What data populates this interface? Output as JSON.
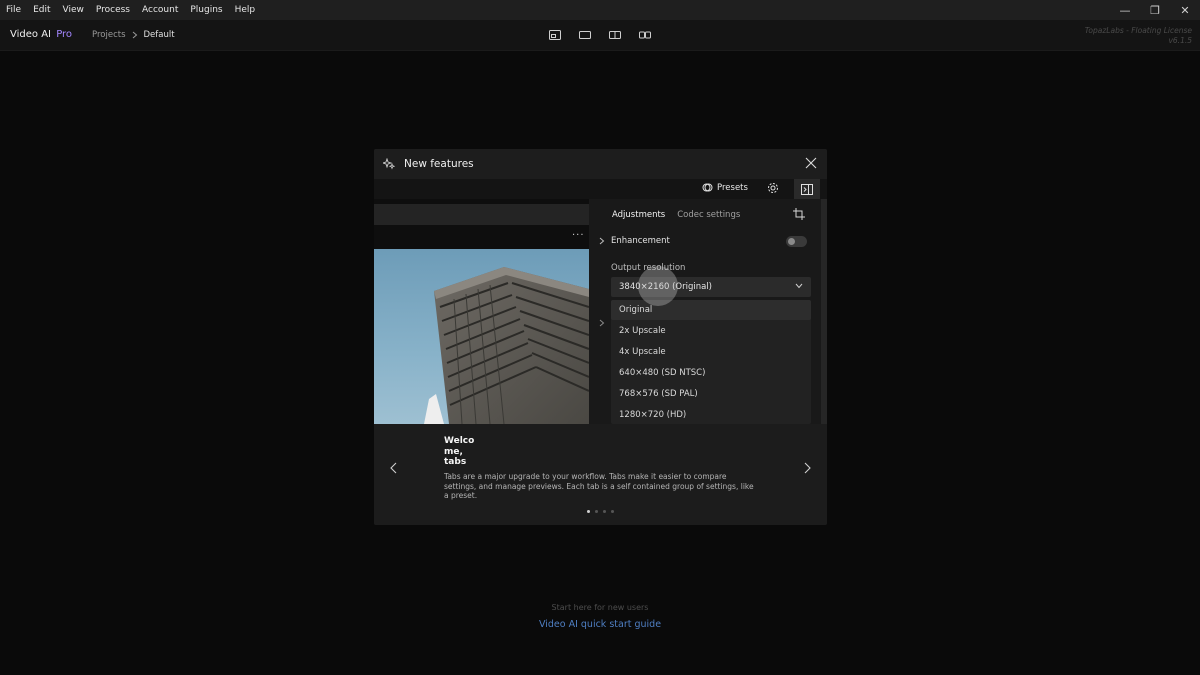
{
  "menubar": {
    "items": [
      "File",
      "Edit",
      "View",
      "Process",
      "Account",
      "Plugins",
      "Help"
    ]
  },
  "window_controls": {
    "minimize": "—",
    "restore": "❐",
    "close": "✕"
  },
  "app": {
    "name": "Video AI",
    "edition": "Pro",
    "breadcrumb": {
      "root": "Projects",
      "current": "Default"
    },
    "license_line1": "TopazLabs - Floating License",
    "license_line2": "v6.1.5"
  },
  "modal": {
    "title": "New features",
    "preview": {
      "presets_label": "Presets",
      "more_dots": "···",
      "tabs": [
        "Adjustments",
        "Codec settings"
      ],
      "enhancement_label": "Enhancement",
      "output_resolution_label": "Output resolution",
      "selected_resolution": "3840×2160 (Original)",
      "options": [
        "Original",
        "2x Upscale",
        "4x Upscale",
        "640×480 (SD NTSC)",
        "768×576 (SD PAL)",
        "1280×720 (HD)"
      ]
    },
    "welcome_title": "Welco me, tabs",
    "welcome_lines": [
      "Welco",
      "me,",
      "tabs"
    ],
    "welcome_desc": "Tabs are a major upgrade to your workflow. Tabs make it easier to compare settings, and manage previews. Each tab is a self contained group of settings, like a preset.",
    "pagination": {
      "current": 1,
      "total": 4
    }
  },
  "footer": {
    "hint": "Start here for new users",
    "link": "Video AI quick start guide"
  },
  "colors": {
    "accent_pro": "#a487ff",
    "link": "#4f7fc3"
  }
}
